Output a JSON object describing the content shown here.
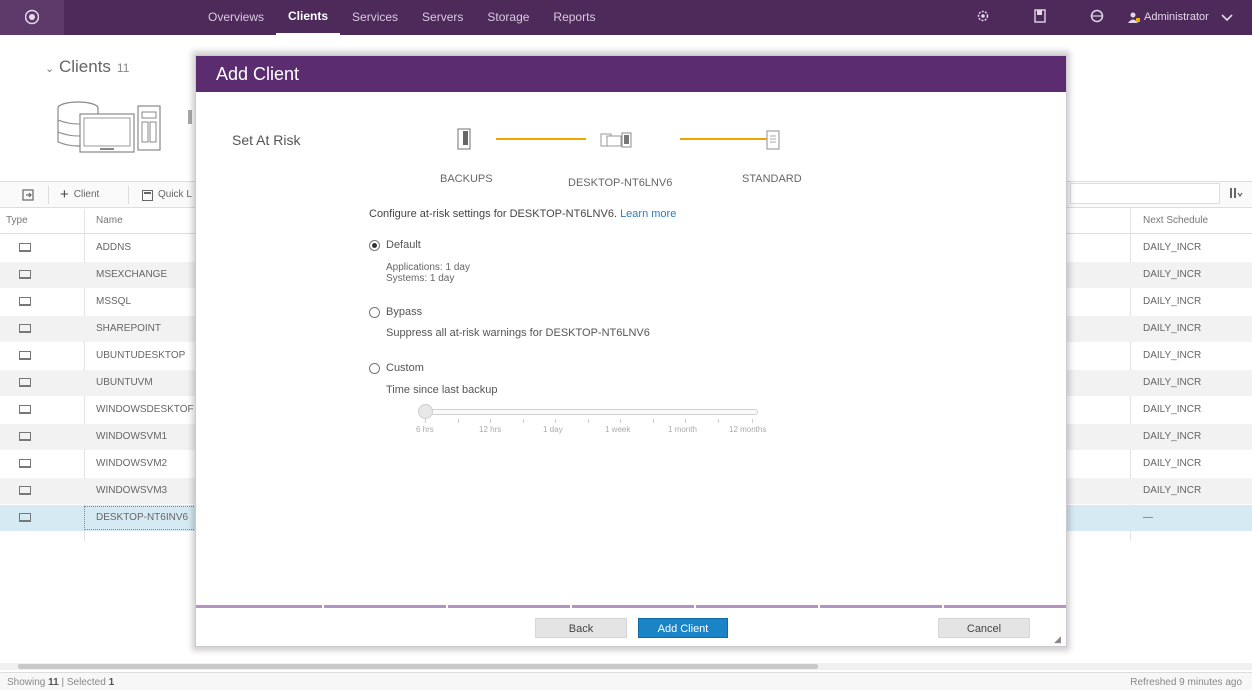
{
  "nav": {
    "items": [
      {
        "label": "Overviews",
        "active": false
      },
      {
        "label": "Clients",
        "active": true
      },
      {
        "label": "Services",
        "active": false
      },
      {
        "label": "Servers",
        "active": false
      },
      {
        "label": "Storage",
        "active": false
      },
      {
        "label": "Reports",
        "active": false
      }
    ],
    "user": "Administrator"
  },
  "page": {
    "title": "Clients",
    "count": "11"
  },
  "toolbar": {
    "add_client": "Client",
    "quick_label": "Quick L"
  },
  "table": {
    "headers": {
      "type": "Type",
      "name": "Name",
      "next_schedule": "Next Schedule"
    },
    "rows": [
      {
        "name": "ADDNS",
        "schedule": "DAILY_INCR"
      },
      {
        "name": "MSEXCHANGE",
        "schedule": "DAILY_INCR"
      },
      {
        "name": "MSSQL",
        "schedule": "DAILY_INCR"
      },
      {
        "name": "SHAREPOINT",
        "schedule": "DAILY_INCR"
      },
      {
        "name": "UBUNTUDESKTOP",
        "schedule": "DAILY_INCR"
      },
      {
        "name": "UBUNTUVM",
        "schedule": "DAILY_INCR"
      },
      {
        "name": "WINDOWSDESKTOF",
        "schedule": "DAILY_INCR"
      },
      {
        "name": "WINDOWSVM1",
        "schedule": "DAILY_INCR"
      },
      {
        "name": "WINDOWSVM2",
        "schedule": "DAILY_INCR"
      },
      {
        "name": "WINDOWSVM3",
        "schedule": "DAILY_INCR"
      },
      {
        "name": "DESKTOP-NT6INV6",
        "schedule": "—"
      }
    ]
  },
  "status": {
    "showing_label": "Showing",
    "showing_count": "11",
    "selected_label": "| Selected",
    "selected_count": "1",
    "refreshed": "Refreshed 9 minutes ago"
  },
  "modal": {
    "title": "Add Client",
    "step_label": "Set At Risk",
    "steps": [
      "BACKUPS",
      "DESKTOP-NT6LNV6",
      "STANDARD"
    ],
    "configure_text": "Configure at-risk settings for DESKTOP-NT6LNV6.",
    "learn_more": "Learn more",
    "options": {
      "default_label": "Default",
      "default_lines": [
        "Applications: 1 day",
        "Systems: 1 day"
      ],
      "bypass_label": "Bypass",
      "bypass_desc": "Suppress all at-risk warnings for DESKTOP-NT6LNV6",
      "custom_label": "Custom",
      "selected": "Default"
    },
    "slider": {
      "label": "Time since last backup",
      "ticks": [
        "6 hrs",
        "12 hrs",
        "1 day",
        "1 week",
        "1 month",
        "12 months"
      ],
      "value_index": 0
    },
    "buttons": {
      "back": "Back",
      "add_client": "Add Client",
      "cancel": "Cancel"
    }
  },
  "colors": {
    "nav_bg": "#4d2a5a",
    "modal_header": "#5b2c6f",
    "step_line": "#f0a500",
    "primary_button": "#1a84c6",
    "selected_row": "#d5eaf2"
  }
}
